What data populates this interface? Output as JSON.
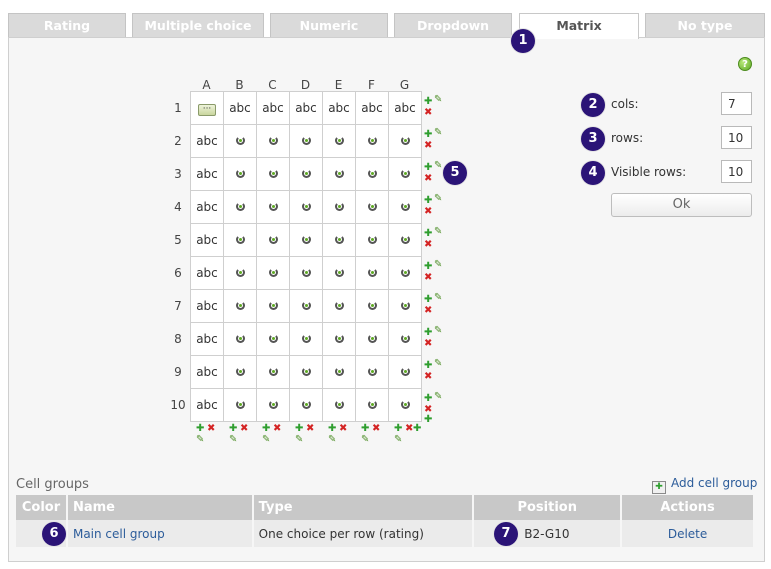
{
  "tabs": [
    {
      "label": "Rating",
      "active": false
    },
    {
      "label": "Multiple choice",
      "active": false
    },
    {
      "label": "Numeric",
      "active": false
    },
    {
      "label": "Dropdown",
      "active": false
    },
    {
      "label": "Matrix",
      "active": true
    },
    {
      "label": "No type",
      "active": false
    }
  ],
  "badges": [
    "1",
    "2",
    "3",
    "4",
    "5",
    "6",
    "7"
  ],
  "help_icon": "?",
  "matrix": {
    "columns": [
      "A",
      "B",
      "C",
      "D",
      "E",
      "F",
      "G"
    ],
    "rows": [
      "1",
      "2",
      "3",
      "4",
      "5",
      "6",
      "7",
      "8",
      "9",
      "10"
    ],
    "cell_text": "abc",
    "menu_glyph": "···",
    "icons": {
      "add": "✚",
      "delete": "✖",
      "edit": "✎"
    }
  },
  "form": {
    "cols_label": "cols:",
    "cols_value": "7",
    "rows_label": "rows:",
    "rows_value": "10",
    "visible_rows_label": "Visible rows:",
    "visible_rows_value": "10",
    "ok_label": "Ok"
  },
  "cell_groups": {
    "title": "Cell groups",
    "add_label": "Add cell group",
    "headers": {
      "color": "Color",
      "name": "Name",
      "type": "Type",
      "position": "Position",
      "actions": "Actions"
    },
    "rows": [
      {
        "color": "",
        "name": "Main cell group",
        "type": "One choice per row (rating)",
        "position": "B2-G10",
        "action": "Delete"
      }
    ]
  },
  "colors": {
    "badge": "#2b1477",
    "link": "#2c5c9a",
    "add": "#2f9e2f",
    "delete": "#d42424"
  }
}
